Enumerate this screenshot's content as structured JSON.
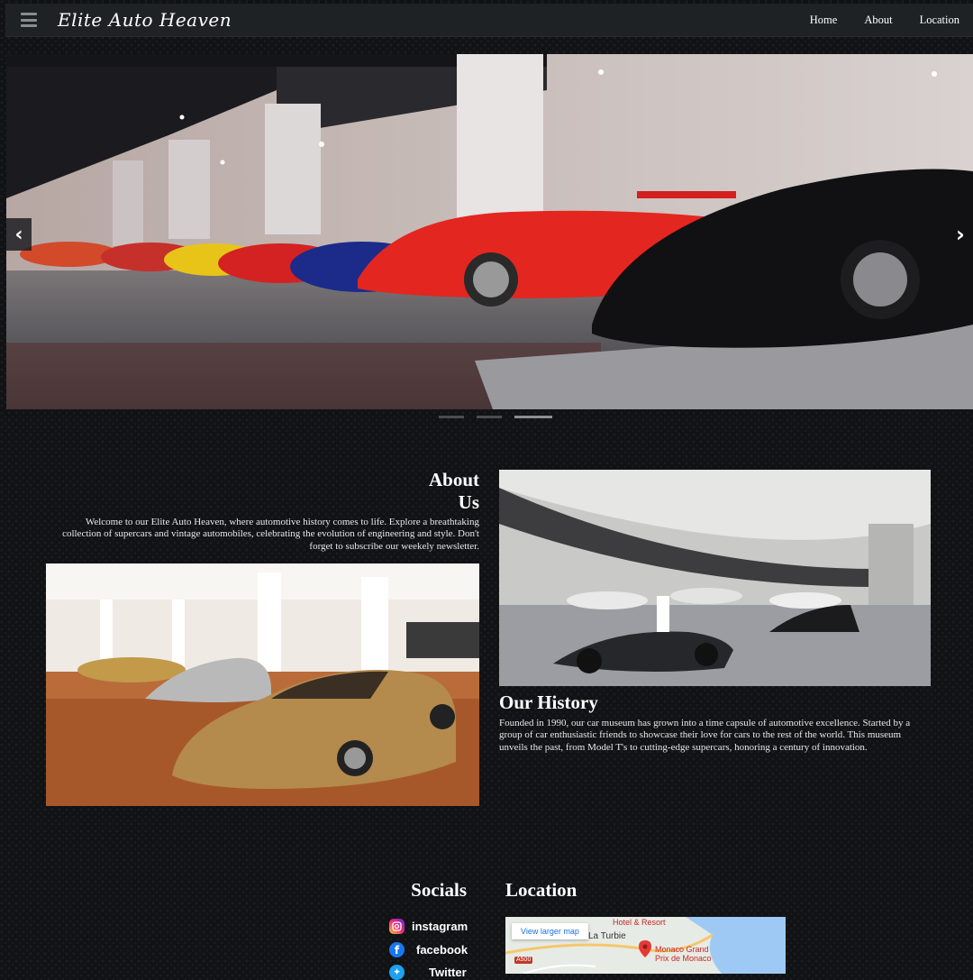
{
  "nav": {
    "brand": "Elite Auto Heaven",
    "links": [
      "Home",
      "About",
      "Location"
    ]
  },
  "carousel": {
    "prev": "‹",
    "next": "›",
    "slide_count": 3,
    "active_index": 2
  },
  "about": {
    "title_line1": "About",
    "title_line2": "Us",
    "text": "Welcome to our Elite Auto Heaven, where automotive history comes to life. Explore a breathtaking collection of supercars and vintage automobiles, celebrating the evolution of engineering and style. Don't forget to subscribe our weekely newsletter."
  },
  "history": {
    "title": "Our History",
    "text": "Founded in 1990, our car museum has grown into a time capsule of automotive excellence. Started by a group of car enthusiastic friends to showcase their love for cars to the rest of the world. This museum unveils the past, from Model T's to cutting-edge supercars, honoring a century of innovation."
  },
  "socials": {
    "title": "Socials",
    "items": [
      {
        "label": "instagram",
        "icon": "instagram-icon",
        "color": "#d6249f"
      },
      {
        "label": "facebook",
        "icon": "facebook-icon",
        "color": "#1877f2"
      },
      {
        "label": "Twitter",
        "icon": "twitter-icon",
        "color": "#1da1f2"
      }
    ]
  },
  "location": {
    "title": "Location",
    "map_link": "View larger map",
    "map_labels": {
      "hotel": "Hotel & Resort",
      "town": "La Turbie",
      "road": "A500",
      "place_line1": "Monaco Grand",
      "place_line2": "Prix de Monaco"
    }
  }
}
